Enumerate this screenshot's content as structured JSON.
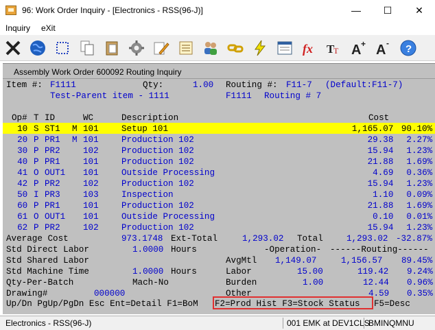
{
  "window": {
    "title": "96: Work Order Inquiry - [Electronics - RSS(96-J)]",
    "minimize": "—",
    "maximize": "☐",
    "close": "✕"
  },
  "menu": {
    "inquiry": "Inquiry",
    "exit": "eXit"
  },
  "toolbar": [
    "exit-icon",
    "globe-icon",
    "select-icon",
    "copy-icon",
    "paste-icon",
    "settings-icon",
    "edit-icon",
    "notes-icon",
    "users-icon",
    "link-icon",
    "lightning-icon",
    "report-icon",
    "function-icon",
    "font-icon",
    "font-larger-icon",
    "font-smaller-icon",
    "help-icon"
  ],
  "inner": {
    "title": "Assembly Work Order 600092 Routing Inquiry",
    "item_label": "Item #:",
    "item_value": "F1111",
    "qty_label": "Qty:",
    "qty_value": "1.00",
    "routing_label": "Routing #:",
    "routing_value": "F11-7",
    "default_label": "(Default:F11-7)",
    "item_desc": "Test-Parent item - 1111",
    "item_code": "F1111",
    "routing_num": "Routing # 7"
  },
  "columns": {
    "op": "Op#",
    "t": "T",
    "id": "ID",
    "wc": "WC",
    "desc": "Description",
    "cost": "Cost"
  },
  "rows": [
    {
      "op": "10",
      "t": "S",
      "id": "ST1",
      "m": "M",
      "wc": "101",
      "desc": "Setup 101",
      "cost": "1,165.07",
      "pct": "90.10%"
    },
    {
      "op": "20",
      "t": "P",
      "id": "PR1",
      "m": "M",
      "wc": "101",
      "desc": "Production 102",
      "cost": "29.38",
      "pct": "2.27%"
    },
    {
      "op": "30",
      "t": "P",
      "id": "PR2",
      "m": "",
      "wc": "102",
      "desc": "Production 102",
      "cost": "15.94",
      "pct": "1.23%"
    },
    {
      "op": "40",
      "t": "P",
      "id": "PR1",
      "m": "",
      "wc": "101",
      "desc": "Production 102",
      "cost": "21.88",
      "pct": "1.69%"
    },
    {
      "op": "41",
      "t": "O",
      "id": "OUT1",
      "m": "",
      "wc": "101",
      "desc": "Outside Processing",
      "cost": "4.69",
      "pct": "0.36%"
    },
    {
      "op": "42",
      "t": "P",
      "id": "PR2",
      "m": "",
      "wc": "102",
      "desc": "Production 102",
      "cost": "15.94",
      "pct": "1.23%"
    },
    {
      "op": "50",
      "t": "I",
      "id": "PR3",
      "m": "",
      "wc": "103",
      "desc": "Inspection",
      "cost": "1.10",
      "pct": "0.09%"
    },
    {
      "op": "60",
      "t": "P",
      "id": "PR1",
      "m": "",
      "wc": "101",
      "desc": "Production 102",
      "cost": "21.88",
      "pct": "1.69%"
    },
    {
      "op": "61",
      "t": "O",
      "id": "OUT1",
      "m": "",
      "wc": "101",
      "desc": "Outside Processing",
      "cost": "0.10",
      "pct": "0.01%"
    },
    {
      "op": "62",
      "t": "P",
      "id": "PR2",
      "m": "",
      "wc": "102",
      "desc": "Production 102",
      "cost": "15.94",
      "pct": "1.23%"
    }
  ],
  "summary": {
    "avg_cost_label": "Average Cost",
    "avg_cost": "973.1748",
    "ext_total_label": "Ext-Total",
    "ext_total": "1,293.02",
    "total_label": "Total",
    "total": "1,293.02",
    "total_pct": "-32.87%",
    "std_dl_label": "Std Direct Labor",
    "std_dl": "1.0000",
    "hours1": "Hours",
    "operation_hdr": "-Operation-",
    "routing_hdr": "------Routing------",
    "std_sl_label": "Std Shared Labor",
    "avgmtl_label": "AvgMtl",
    "avgmtl_op": "1,149.07",
    "avgmtl_rt": "1,156.57",
    "avgmtl_pct": "89.45%",
    "std_mt_label": "Std Machine Time",
    "std_mt": "1.0000",
    "hours2": "Hours",
    "labor_label": "Labor",
    "labor_op": "15.00",
    "labor_rt": "119.42",
    "labor_pct": "9.24%",
    "qpb_label": "Qty-Per-Batch",
    "machno_label": "Mach-No",
    "burden_label": "Burden",
    "burden_op": "1.00",
    "burden_rt": "12.44",
    "burden_pct": "0.96%",
    "drawing_label": "Drawing#",
    "drawing": "000000",
    "other_label": "Other",
    "other_rt": "4.59",
    "other_pct": "0.35%"
  },
  "keys": {
    "nav": "Up/Dn PgUp/PgDn Esc Ent=Detail F1=BoM",
    "f2f3": "F2=Prod Hist F3=Stock Status",
    "f5": "F5=Desc"
  },
  "status": {
    "left": "Electronics - RSS(96-J)",
    "mid": "001 EMK at DEV1CLS",
    "right": "BMINQMNU"
  },
  "colors": {
    "highlight": "#ffff00",
    "value_blue": "#0000cc",
    "outline_red": "#e03030"
  }
}
